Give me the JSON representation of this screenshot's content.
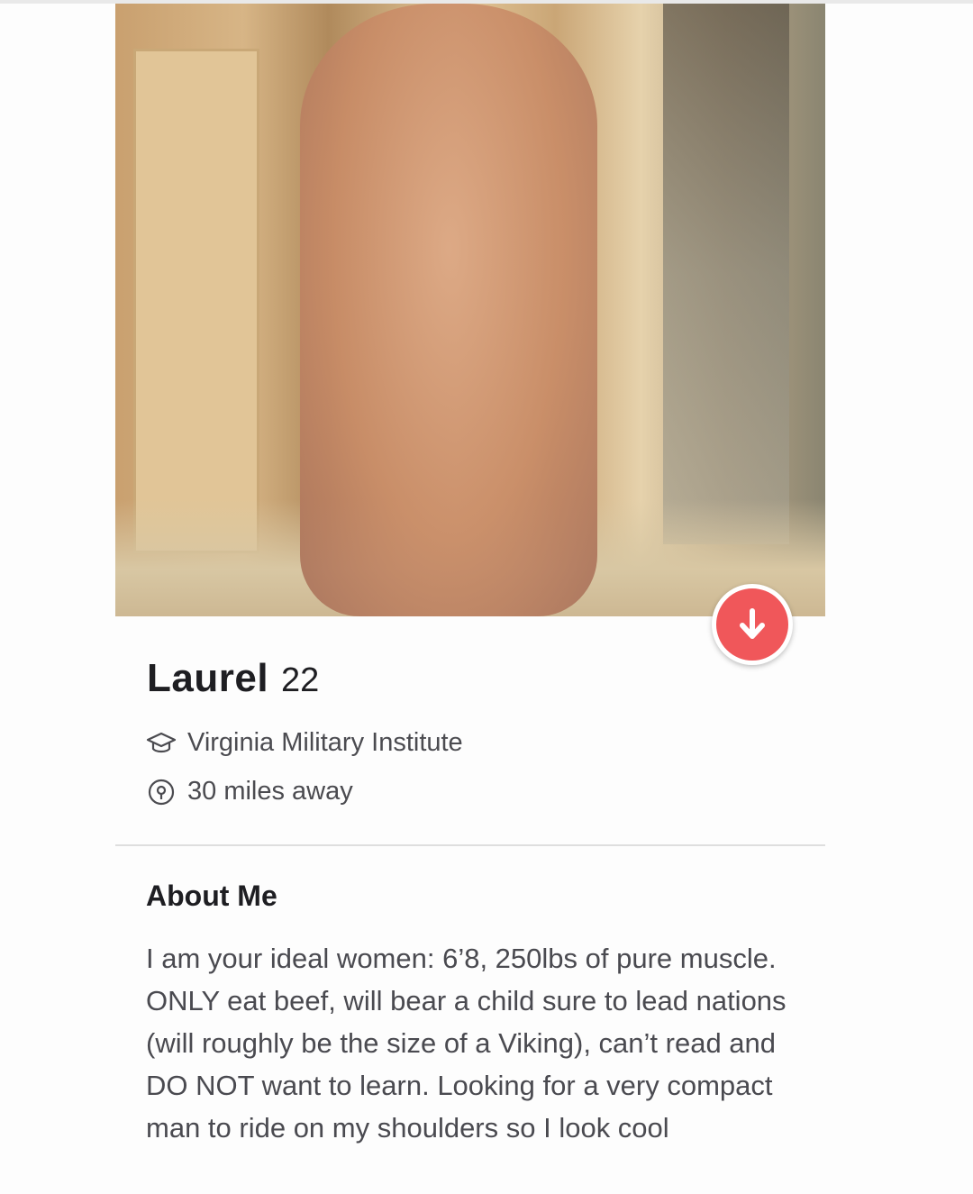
{
  "profile": {
    "name": "Laurel",
    "age": "22",
    "school": "Virginia Military Institute",
    "distance": "30 miles away"
  },
  "about": {
    "heading": "About Me",
    "body": "I am your ideal women: 6’8, 250lbs of pure muscle. ONLY eat beef, will bear a child sure to lead nations (will roughly be the size of a Viking), can’t read and DO NOT want to learn. Looking for a very compact man to ride on my shoulders so I look cool"
  },
  "icons": {
    "badge": "arrow-down-icon",
    "school": "graduation-cap-icon",
    "distance": "location-pin-icon"
  },
  "colors": {
    "badge": "#f0575a",
    "name_text": "#1e1e22",
    "info_text": "#4b4b50"
  }
}
